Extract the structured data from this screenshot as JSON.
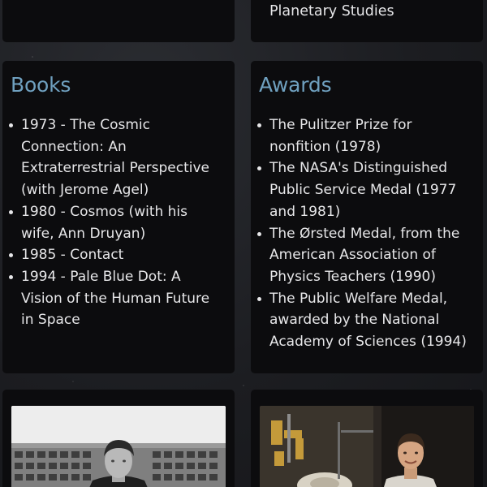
{
  "previous_cards": {
    "right_tail_text": "Planetary Studies"
  },
  "books": {
    "title": "Books",
    "items": [
      "1973 - The Cosmic Connection: An Extraterrestrial Perspective (with Jerome Agel)",
      "1980 - Cosmos (with his wife, Ann Druyan)",
      "1985 - Contact",
      "1994 - Pale Blue Dot: A Vision of the Human Future in Space"
    ]
  },
  "awards": {
    "title": "Awards",
    "items": [
      "The Pulitzer Prize for nonfition (1978)",
      "The NASA's Distinguished Public Service Medal (1977 and 1981)",
      "The Ørsted Medal, from the American Association of Physics Teachers (1990)",
      "The Public Welfare Medal, awarded by the National Academy of Sciences (1994)"
    ]
  },
  "colors": {
    "heading_accent": "#6fa0bf",
    "card_background": "#0c0c0e",
    "page_background": "#1c1d21"
  }
}
